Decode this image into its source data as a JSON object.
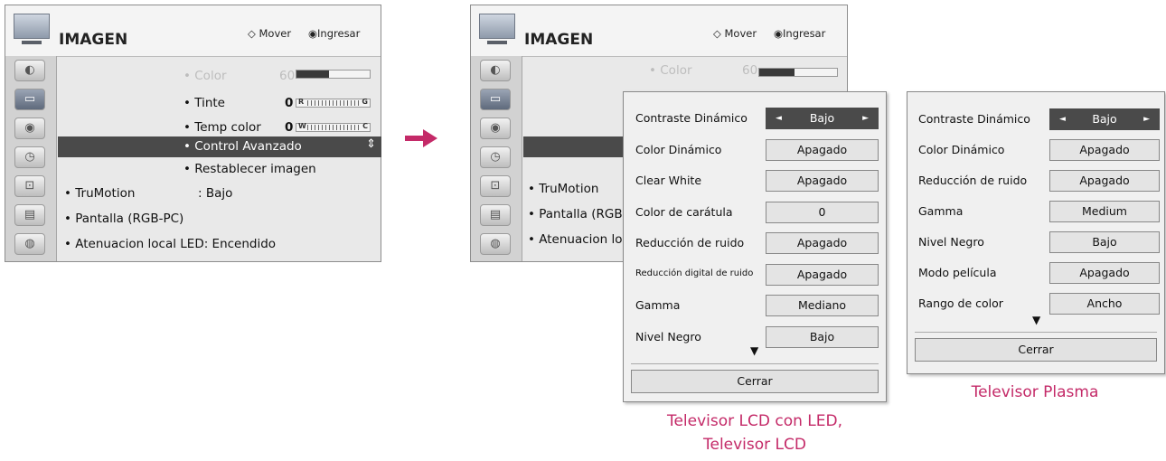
{
  "menu": {
    "title": "IMAGEN",
    "hint_move": "◇ Mover",
    "hint_enter": "◉Ingresar",
    "color_label": "• Color",
    "color_value": "60",
    "tint_label": "• Tinte",
    "tint_value": "0",
    "temp_label": "• Temp color",
    "temp_value": "0",
    "advanced_label": "• Control Avanzado",
    "reset_label": "• Restablecer imagen",
    "trumotion_label": "• TruMotion",
    "trumotion_value": ": Bajo",
    "screen_label": "• Pantalla (RGB-PC)",
    "dimming_label": "• Atenuacion local LED: Encendido",
    "screen_label_cut": "• Pantalla (RGB-",
    "dimming_label_cut": "• Atenuacion loc",
    "bar_r": "R",
    "bar_g": "G",
    "bar_w": "W",
    "bar_c": "C",
    "color_level": 0.45
  },
  "lcd_popup": {
    "rows": [
      {
        "label": "Contraste Dinámico",
        "value": "Bajo"
      },
      {
        "label": "Color Dinámico",
        "value": "Apagado"
      },
      {
        "label": "Clear White",
        "value": "Apagado"
      },
      {
        "label": "Color de carátula",
        "value": "0"
      },
      {
        "label": "Reducción de ruido",
        "value": "Apagado"
      },
      {
        "label": "Reducción digital de ruido",
        "value": "Apagado"
      },
      {
        "label": "Gamma",
        "value": "Mediano"
      },
      {
        "label": "Nivel Negro",
        "value": "Bajo"
      }
    ],
    "more": "▼",
    "close": "Cerrar",
    "caption_line1": "Televisor LCD con LED,",
    "caption_line2": "Televisor LCD"
  },
  "plasma_popup": {
    "rows": [
      {
        "label": "Contraste Dinámico",
        "value": "Bajo"
      },
      {
        "label": "Color Dinámico",
        "value": "Apagado"
      },
      {
        "label": "Reducción de ruido",
        "value": "Apagado"
      },
      {
        "label": "Gamma",
        "value": "Medium"
      },
      {
        "label": "Nivel Negro",
        "value": "Bajo"
      },
      {
        "label": "Modo película",
        "value": "Apagado"
      },
      {
        "label": "Rango de color",
        "value": "Ancho"
      }
    ],
    "more": "▼",
    "close": "Cerrar",
    "caption": "Televisor Plasma"
  },
  "colors": {
    "accent": "#c42a68",
    "highlight": "#4a4a4a"
  }
}
